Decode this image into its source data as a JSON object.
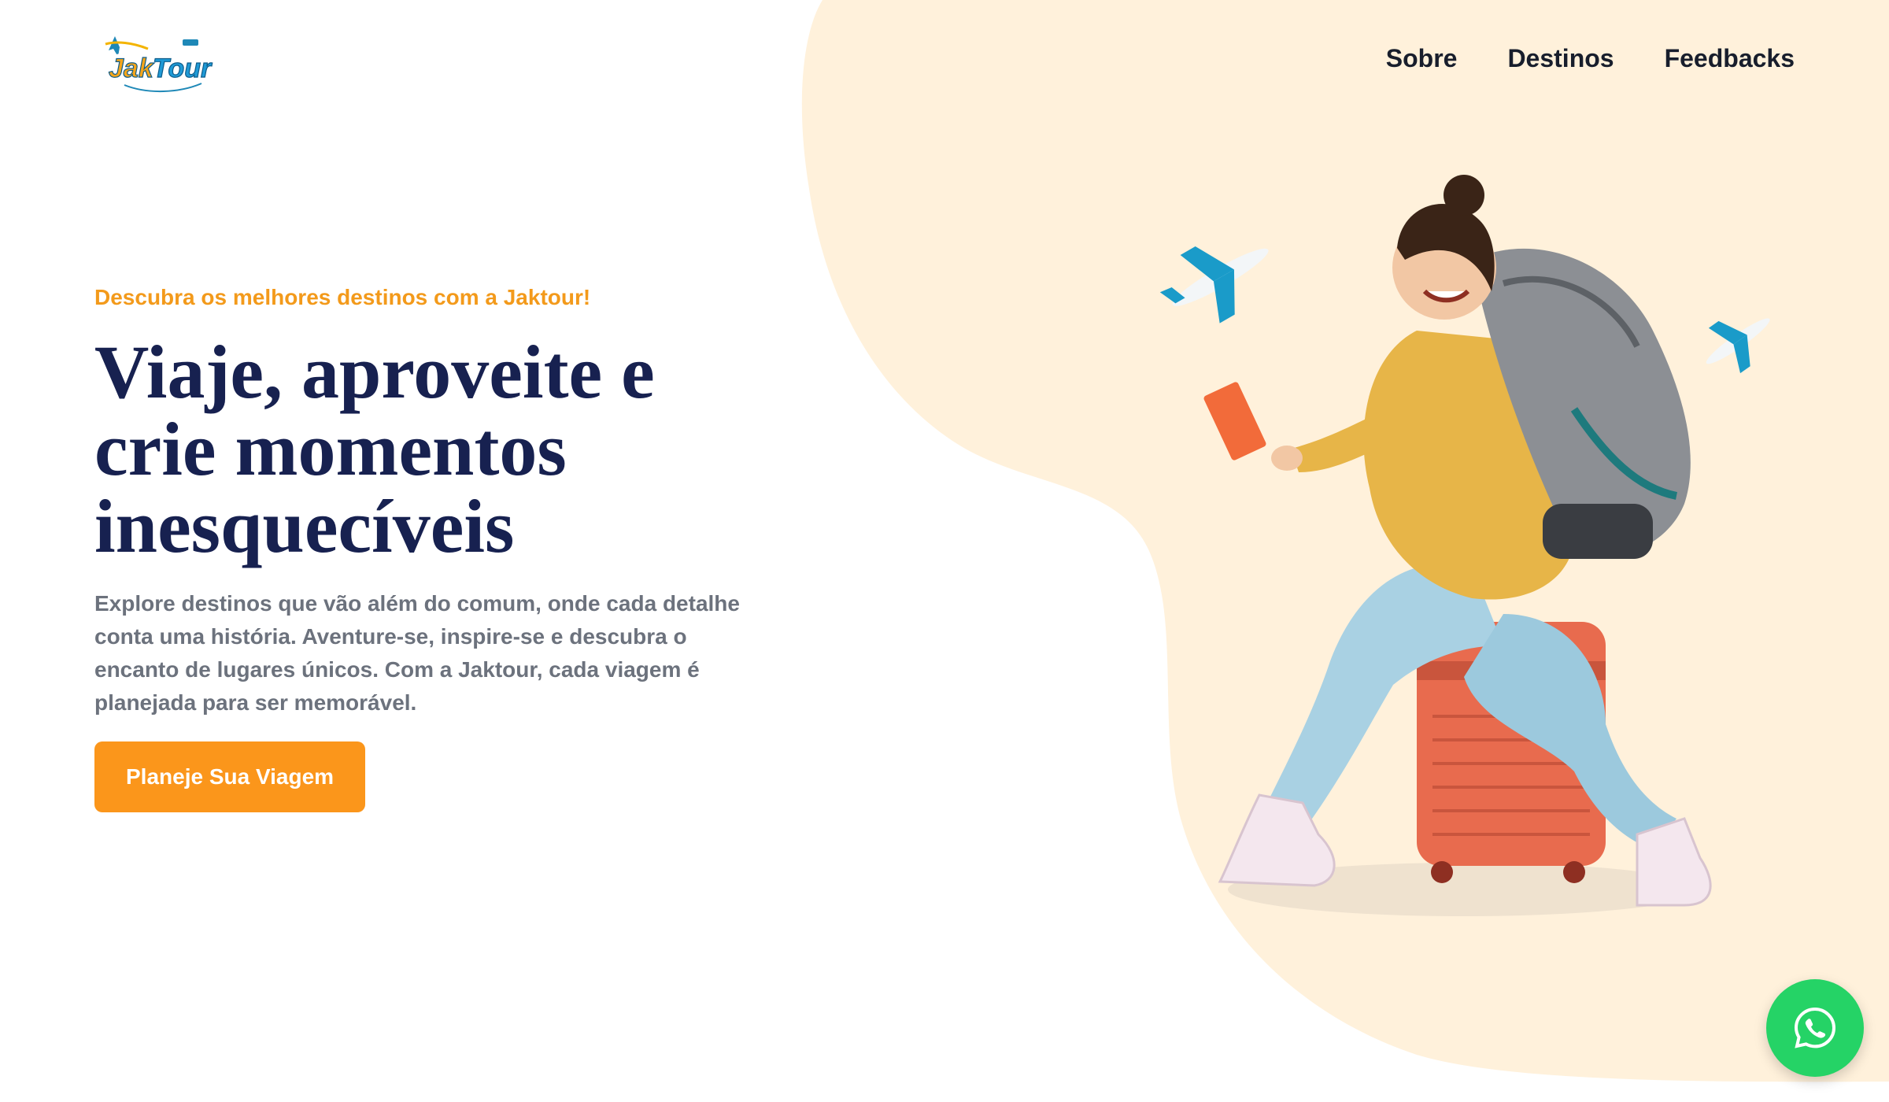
{
  "header": {
    "logo_text": "JakTour",
    "nav": [
      {
        "label": "Sobre"
      },
      {
        "label": "Destinos"
      },
      {
        "label": "Feedbacks"
      }
    ]
  },
  "hero": {
    "eyebrow": "Descubra os melhores destinos com a Jaktour!",
    "headline": "Viaje, aproveite e crie momentos inesquecíveis",
    "description": "Explore destinos que vão além do comum, onde cada detalhe conta uma história. Aventure-se, inspire-se e descubra o encanto de lugares únicos. Com a Jaktour, cada viagem é planejada para ser memorável.",
    "cta_label": "Planeje Sua Viagem"
  },
  "floating": {
    "icon": "whatsapp-icon"
  },
  "colors": {
    "accent": "#fb961b",
    "eyebrow": "#f39a1b",
    "headline": "#172150",
    "body_text": "#6c727d",
    "nav_text": "#181e2c",
    "blob": "#fff1db",
    "whatsapp": "#25d366"
  }
}
